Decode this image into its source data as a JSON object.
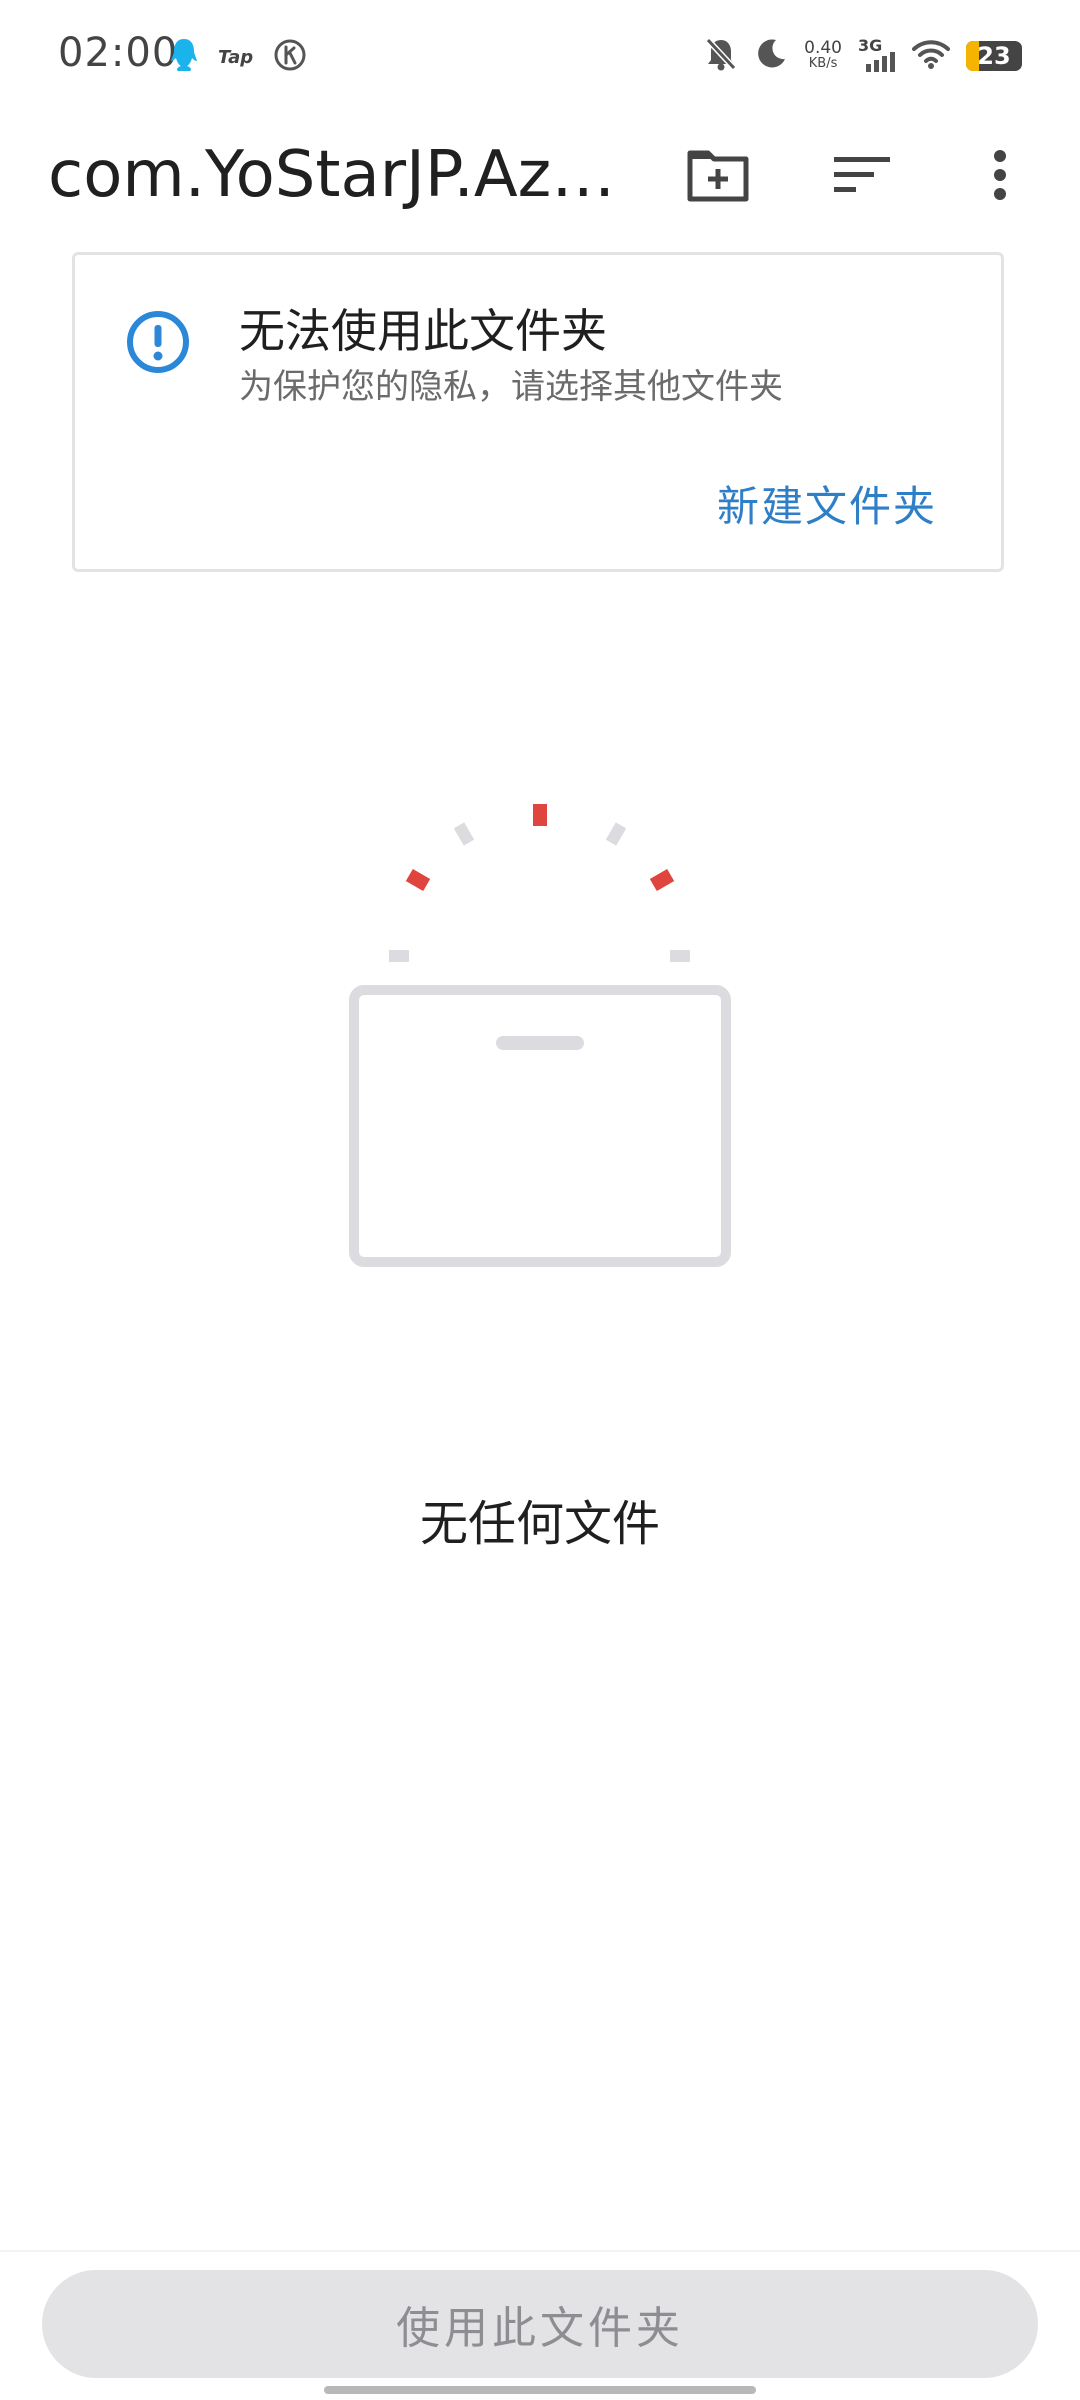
{
  "status_bar": {
    "time": "02:00",
    "left_icons": [
      "qq-icon",
      "taptap-icon",
      "clock-badge-icon"
    ],
    "tap_label": "Tap",
    "net_speed_value": "0.40",
    "net_speed_unit": "KB/s",
    "network_type": "3G",
    "battery_level": "23",
    "battery_fraction": 0.23,
    "right_icons": [
      "mute-bell-icon",
      "moon-icon",
      "signal-icon",
      "wifi-icon",
      "battery-icon"
    ]
  },
  "app_bar": {
    "title": "com.YoStarJP.Az…",
    "actions": [
      "new-folder-icon",
      "sort-icon",
      "more-vert-icon"
    ]
  },
  "warning_card": {
    "icon": "alert-circle-icon",
    "title": "无法使用此文件夹",
    "subtitle": "为保护您的隐私，请选择其他文件夹",
    "action_label": "新建文件夹"
  },
  "empty_state": {
    "illustration": "empty-folder-box-icon",
    "message": "无任何文件"
  },
  "bottom": {
    "primary_button_label": "使用此文件夹"
  },
  "colors": {
    "accent_blue": "#2e7fc7",
    "warning_icon_blue": "#2b88d8",
    "spark_red": "#e0443e",
    "spark_grey": "#dcdce0",
    "button_bg_disabled": "#e3e3e6",
    "button_text_disabled": "#8d8d92"
  }
}
